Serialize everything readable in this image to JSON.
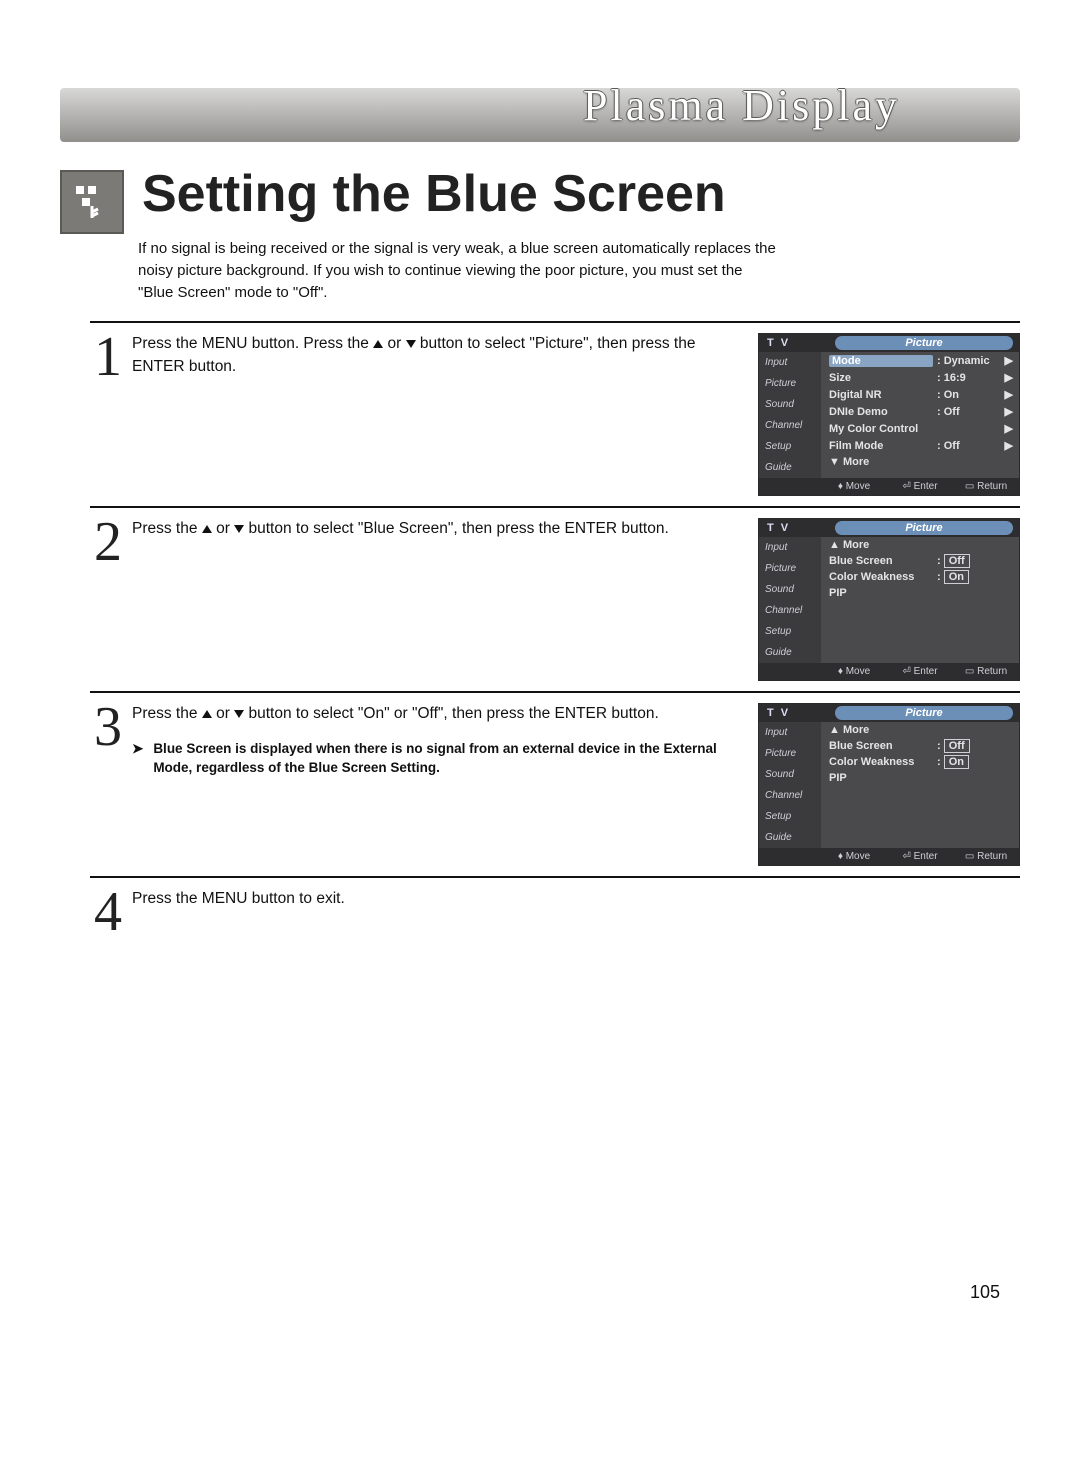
{
  "brand": "Plasma Display",
  "title": "Setting the Blue Screen",
  "intro": "If no signal is being received or the signal is very weak, a blue screen automatically replaces the noisy picture background. If you wish to continue viewing the poor picture, you must set the \"Blue Screen\" mode to \"Off\".",
  "page_number": "105",
  "steps": [
    {
      "num": "1",
      "text_a": "Press the MENU button. Press the ",
      "text_b": " or ",
      "text_c": " button to select \"Picture\", then press the ENTER button."
    },
    {
      "num": "2",
      "text_a": "Press the ",
      "text_b": " or ",
      "text_c": " button to select \"Blue Screen\", then press the ENTER button."
    },
    {
      "num": "3",
      "text_a": "Press the ",
      "text_b": " or ",
      "text_c": " button to select \"On\" or \"Off\", then press the ENTER button.",
      "note": "Blue Screen is displayed when there is no signal from an external device in the External Mode, regardless of the Blue Screen Setting."
    },
    {
      "num": "4",
      "text": "Press the MENU button to exit."
    }
  ],
  "osd_side": [
    "Input",
    "Picture",
    "Sound",
    "Channel",
    "Setup",
    "Guide"
  ],
  "osd_tv": "T V",
  "osd_tab": "Picture",
  "osd_foot": {
    "move": "Move",
    "enter": "Enter",
    "return": "Return"
  },
  "osd1_rows": [
    {
      "lbl": "Mode",
      "val": ": Dynamic",
      "arr": "▶",
      "hl": true
    },
    {
      "lbl": "Size",
      "val": ": 16:9",
      "arr": "▶"
    },
    {
      "lbl": "Digital NR",
      "val": ": On",
      "arr": "▶"
    },
    {
      "lbl": "DNIe Demo",
      "val": ": Off",
      "arr": "▶"
    },
    {
      "lbl": "My Color Control",
      "val": "",
      "arr": "▶"
    },
    {
      "lbl": "Film Mode",
      "val": ": Off",
      "arr": "▶"
    },
    {
      "lbl": "▼ More",
      "val": "",
      "arr": ""
    }
  ],
  "osd2_rows": [
    {
      "lbl": "▲ More",
      "val": "",
      "arr": ""
    },
    {
      "lbl": "Blue Screen",
      "val": "Off",
      "arr": "",
      "boxed": true,
      "prefix": ": "
    },
    {
      "lbl": "Color Weakness",
      "val": "On",
      "arr": "",
      "boxed": true,
      "prefix": ": "
    },
    {
      "lbl": "PIP",
      "val": "",
      "arr": ""
    }
  ],
  "osd3_rows": [
    {
      "lbl": "▲ More",
      "val": "",
      "arr": ""
    },
    {
      "lbl": "Blue Screen",
      "val": "Off",
      "arr": "",
      "boxed": true,
      "prefix": ": "
    },
    {
      "lbl": "Color Weakness",
      "val": "On",
      "arr": "",
      "boxed": true,
      "prefix": ": "
    },
    {
      "lbl": "PIP",
      "val": "",
      "arr": ""
    }
  ]
}
